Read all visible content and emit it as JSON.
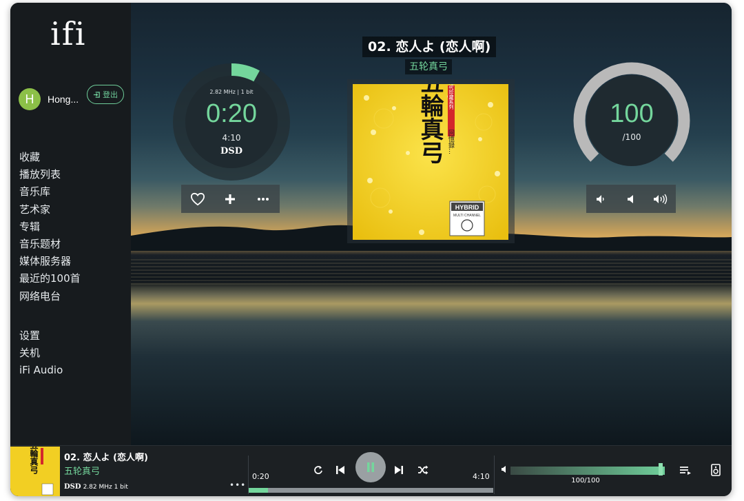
{
  "app": {
    "logo": "ifi"
  },
  "user": {
    "initial": "H",
    "name": "Hong...",
    "logout_label": "登出"
  },
  "sidebar": {
    "items": [
      "收藏",
      "播放列表",
      "音乐库",
      "艺术家",
      "专辑",
      "音乐题材",
      "媒体服务器",
      "最近的100首",
      "网络电台"
    ],
    "bottom_items": [
      "设置",
      "关机",
      "iFi Audio"
    ]
  },
  "now_playing": {
    "title": "02. 恋人よ (恋人啊)",
    "artist": "五轮真弓",
    "sample_rate": "2.82 MHz | 1 bit",
    "elapsed": "0:20",
    "duration": "4:10",
    "format": "DSD",
    "progress_fraction": 0.08
  },
  "album": {
    "main_text": "五輪真弓",
    "series_text": "好時代珍藏系列",
    "sub_text": "回憶録…",
    "badge_line1": "HYBRID",
    "badge_line2": "MULTI CHANNEL"
  },
  "volume": {
    "value": "100",
    "max": "/100",
    "level_fraction": 1.0,
    "bar_label": "100/100"
  },
  "player": {
    "title": "02. 恋人よ (恋人啊)",
    "artist": "五轮真弓",
    "format": "DSD",
    "rate": "2.82 MHz 1 bit",
    "elapsed": "0:20",
    "duration": "4:10",
    "more": "•••"
  },
  "colors": {
    "accent": "#74d69c",
    "sidebar_bg": "#171b1e",
    "player_bg": "#1c2023",
    "album_yellow": "#f2cf23"
  }
}
